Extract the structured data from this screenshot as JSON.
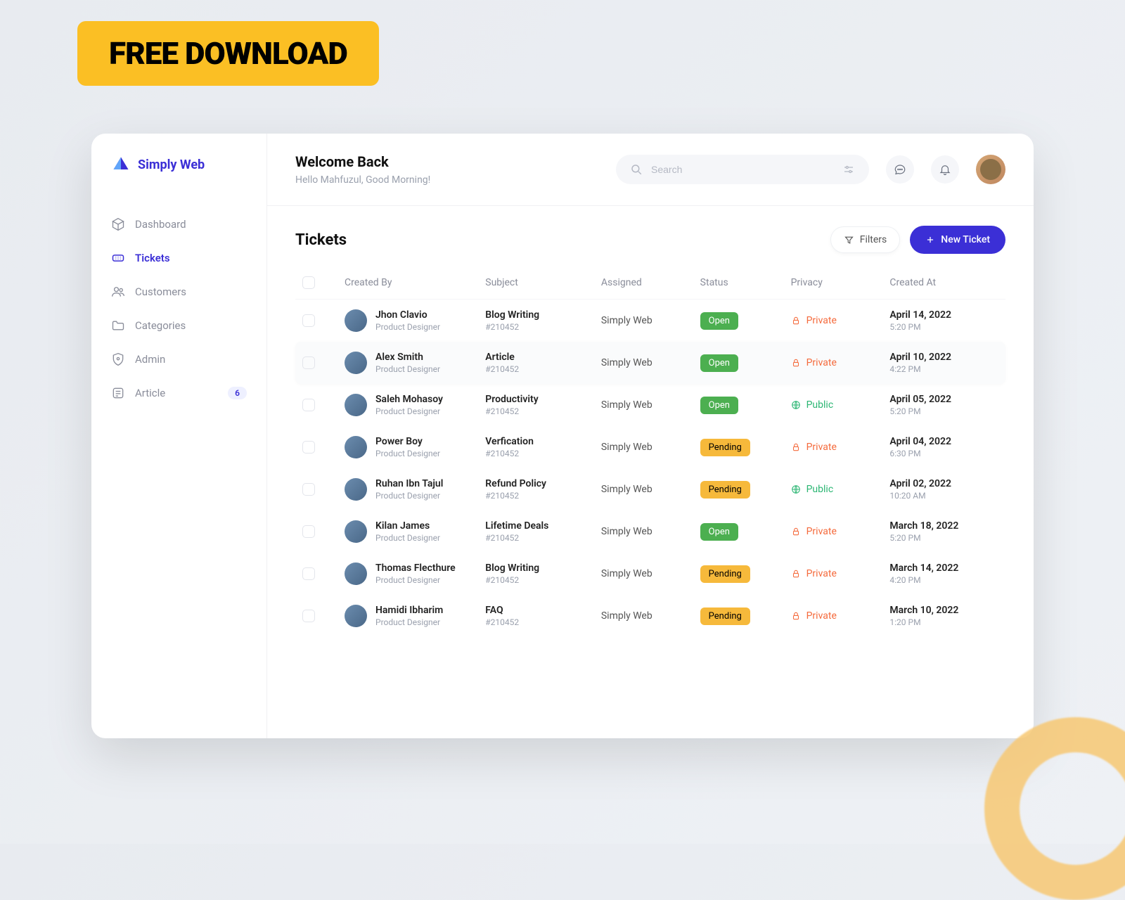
{
  "promo": {
    "badge": "FREE DOWNLOAD"
  },
  "brand": {
    "name": "Simply Web"
  },
  "nav": {
    "items": [
      {
        "label": "Dashboard",
        "key": "dashboard"
      },
      {
        "label": "Tickets",
        "key": "tickets"
      },
      {
        "label": "Customers",
        "key": "customers"
      },
      {
        "label": "Categories",
        "key": "categories"
      },
      {
        "label": "Admin",
        "key": "admin"
      },
      {
        "label": "Article",
        "key": "article",
        "badge": "6"
      }
    ]
  },
  "header": {
    "title": "Welcome Back",
    "subtitle": "Hello Mahfuzul, Good Morning!",
    "search_placeholder": "Search"
  },
  "page": {
    "title": "Tickets",
    "filters_label": "Filters",
    "new_label": "New Ticket"
  },
  "columns": {
    "created_by": "Created By",
    "subject": "Subject",
    "assigned": "Assigned",
    "status": "Status",
    "privacy": "Privacy",
    "created_at": "Created At"
  },
  "rows": [
    {
      "name": "Jhon Clavio",
      "role": "Product Designer",
      "subject": "Blog Writing",
      "ticket_id": "#210452",
      "assigned": "Simply Web",
      "status": "Open",
      "privacy": "Private",
      "date": "April 14, 2022",
      "time": "5:20 PM"
    },
    {
      "name": "Alex Smith",
      "role": "Product Designer",
      "subject": "Article",
      "ticket_id": "#210452",
      "assigned": "Simply Web",
      "status": "Open",
      "privacy": "Private",
      "date": "April 10, 2022",
      "time": "4:22 PM"
    },
    {
      "name": "Saleh Mohasoy",
      "role": "Product Designer",
      "subject": "Productivity",
      "ticket_id": "#210452",
      "assigned": "Simply Web",
      "status": "Open",
      "privacy": "Public",
      "date": "April 05, 2022",
      "time": "5:20 PM"
    },
    {
      "name": "Power Boy",
      "role": "Product Designer",
      "subject": "Verfication",
      "ticket_id": "#210452",
      "assigned": "Simply Web",
      "status": "Pending",
      "privacy": "Private",
      "date": "April 04, 2022",
      "time": "6:30 PM"
    },
    {
      "name": "Ruhan Ibn Tajul",
      "role": "Product Designer",
      "subject": "Refund Policy",
      "ticket_id": "#210452",
      "assigned": "Simply Web",
      "status": "Pending",
      "privacy": "Public",
      "date": "April 02, 2022",
      "time": "10:20 AM"
    },
    {
      "name": "Kilan James",
      "role": "Product Designer",
      "subject": "Lifetime Deals",
      "ticket_id": "#210452",
      "assigned": "Simply Web",
      "status": "Open",
      "privacy": "Private",
      "date": "March 18, 2022",
      "time": "5:20 PM"
    },
    {
      "name": "Thomas Flecthure",
      "role": "Product Designer",
      "subject": "Blog Writing",
      "ticket_id": "#210452",
      "assigned": "Simply Web",
      "status": "Pending",
      "privacy": "Private",
      "date": "March 14, 2022",
      "time": "4:20 PM"
    },
    {
      "name": "Hamidi Ibharim",
      "role": "Product Designer",
      "subject": "FAQ",
      "ticket_id": "#210452",
      "assigned": "Simply Web",
      "status": "Pending",
      "privacy": "Private",
      "date": "March 10, 2022",
      "time": "1:20 PM"
    }
  ]
}
